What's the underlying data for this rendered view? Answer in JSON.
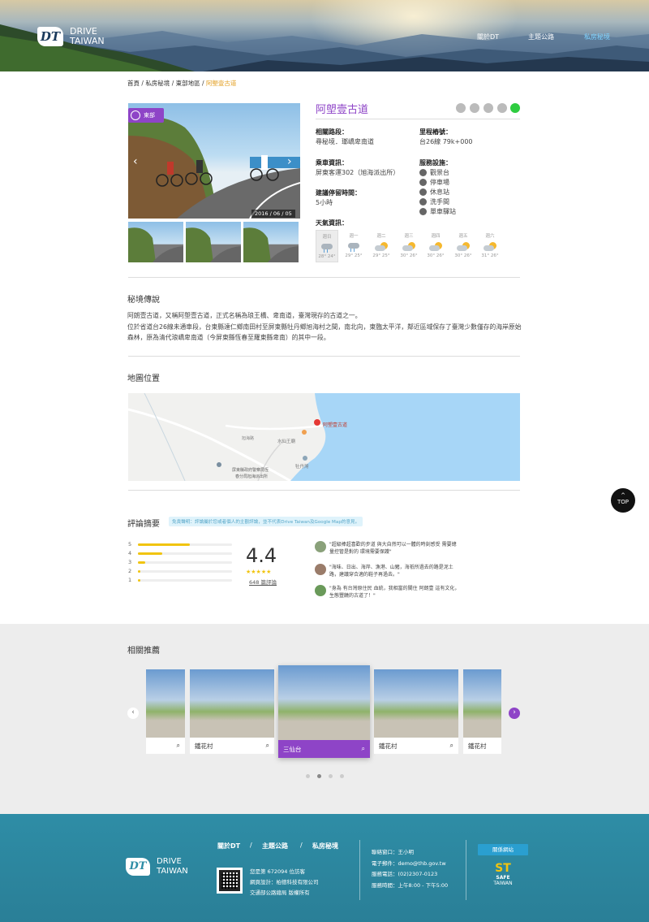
{
  "header": {
    "logo_mark": "DT",
    "logo_line1": "DRIVE",
    "logo_line2": "TAIWAN",
    "nav": [
      {
        "label": "關於DT"
      },
      {
        "label": "主題公路"
      },
      {
        "label": "私房秘境",
        "active": true
      }
    ]
  },
  "breadcrumb": {
    "items": [
      "首頁",
      "私房秘境",
      "東部地區"
    ],
    "separator": "/",
    "current": "阿塱壹古道"
  },
  "gallery": {
    "badge": "東部",
    "date": "2016 / 06 / 05",
    "prev_icon": "chevron-left-icon",
    "next_icon": "chevron-right-icon"
  },
  "detail": {
    "title": "阿塱壹古道",
    "share_icons": [
      "info-icon",
      "location-pin-icon",
      "facebook-icon",
      "twitter-icon",
      "line-icon"
    ],
    "related_route_label": "相關路段：",
    "related_route_value": "尋秘境．瑯嶠卑南道",
    "mileage_label": "里程樁號：",
    "mileage_value": "台26線 79k+000",
    "bus_label": "乘車資訊：",
    "bus_value": "屏東客運302（旭海派出所）",
    "stay_label": "建議停留時間：",
    "stay_value": "5小時",
    "facility_label": "服務設施：",
    "facilities": [
      {
        "icon": "viewpoint-icon",
        "label": "觀景台"
      },
      {
        "icon": "parking-icon",
        "label": "停車場"
      },
      {
        "icon": "rest-area-icon",
        "label": "休息站"
      },
      {
        "icon": "restroom-icon",
        "label": "洗手間"
      },
      {
        "icon": "bike-station-icon",
        "label": "單車驛站"
      }
    ],
    "weather_label": "天氣資訊：",
    "weather": [
      {
        "day": "週日",
        "icon": "rain-icon",
        "temp": "28° 24°"
      },
      {
        "day": "週一",
        "icon": "rain-icon",
        "temp": "29° 25°"
      },
      {
        "day": "週二",
        "icon": "sun-cloud-icon",
        "temp": "29° 25°"
      },
      {
        "day": "週三",
        "icon": "sun-cloud-icon",
        "temp": "30° 26°"
      },
      {
        "day": "週四",
        "icon": "sun-cloud-icon",
        "temp": "30° 26°"
      },
      {
        "day": "週五",
        "icon": "sun-cloud-icon",
        "temp": "30° 26°"
      },
      {
        "day": "週六",
        "icon": "sun-cloud-icon",
        "temp": "31° 26°"
      }
    ]
  },
  "legend": {
    "heading": "秘境傳說",
    "paragraph1": "阿朗壹古道，又稱阿塱壹古道，正式名稱為琅王橋、卑南道，臺灣現存的古道之一。",
    "paragraph2": "位於省道台26線未通車段，台東縣達仁鄉南田村至屏東縣牡丹鄉旭海村之間，南北向，東臨太平洋，鄰近區域保存了臺灣少數僅存的海岸原始森林，原為清代琅嶠卑南道（今屏東縣恆春至羅東縣卑南）的其中一段。"
  },
  "map": {
    "heading": "地圖位置",
    "marker_label": "阿塱壹古道",
    "place1": "水仙王廟",
    "place2": "牡丹灣",
    "place3a": "屏東縣政府警察局恆",
    "place3b": "春分局旭海派出所",
    "road": "旭海路"
  },
  "reviews": {
    "heading": "評論摘要",
    "notice": "免責聲明：評論屬於您或者個人的主觀評論，並不代表Drive Taiwan及Google Map的意見。",
    "bars": [
      {
        "stars": "5",
        "share": 0.55
      },
      {
        "stars": "4",
        "share": 0.26
      },
      {
        "stars": "3",
        "share": 0.08
      },
      {
        "stars": "2",
        "share": 0.03
      },
      {
        "stars": "1",
        "share": 0.03
      }
    ],
    "score": "4.4",
    "stars_text": "★★★★★",
    "count": "648 篇評論",
    "items": [
      {
        "text": "\"超級棒超喜歡的步道 與大自然可以一體的時刻感受 需要總量控管是對的 環境需要保護\""
      },
      {
        "text": "\"海味、日出、海岸、漁港、山豬，海祇所過去的路是泥土路，建議穿合適的鞋子再過去。\""
      },
      {
        "text": "\"身為 有台灣原住民 血統，我相當的關住 阿朗壹 這有文化，生態豐饒的古道了！\""
      }
    ]
  },
  "top_button": {
    "arrow": "^",
    "label": "TOP"
  },
  "related": {
    "heading": "相關推薦",
    "cards": [
      {
        "label": ""
      },
      {
        "label": "鐵花村"
      },
      {
        "label": "三仙台"
      },
      {
        "label": "鐵花村"
      },
      {
        "label": "鐵花村"
      }
    ]
  },
  "footer": {
    "links": [
      "關於DT",
      "主題公路",
      "私房秘境"
    ],
    "link_sep": "/",
    "visitor": "您是第 672094 位訪客",
    "designer": "網頁設計：柏德科技有限公司",
    "owner": "交通部公路總局 版權所有",
    "contact_window": "聯絡窗口：王小明",
    "email": "電子郵件：demo@thb.gov.tw",
    "phone": "服務電話：(02)2307-0123",
    "hours": "服務時間：上午8:00 - 下午5:00",
    "related_site": "關係網站",
    "safe_logo_line1": "SAFE",
    "safe_logo_line2": "TAIWAN"
  },
  "colors": {
    "accent_purple": "#8e44c7",
    "breadcrumb_current": "#e29c1b",
    "footer_teal": "#2e8da6",
    "star_yellow": "#f1c40f"
  }
}
